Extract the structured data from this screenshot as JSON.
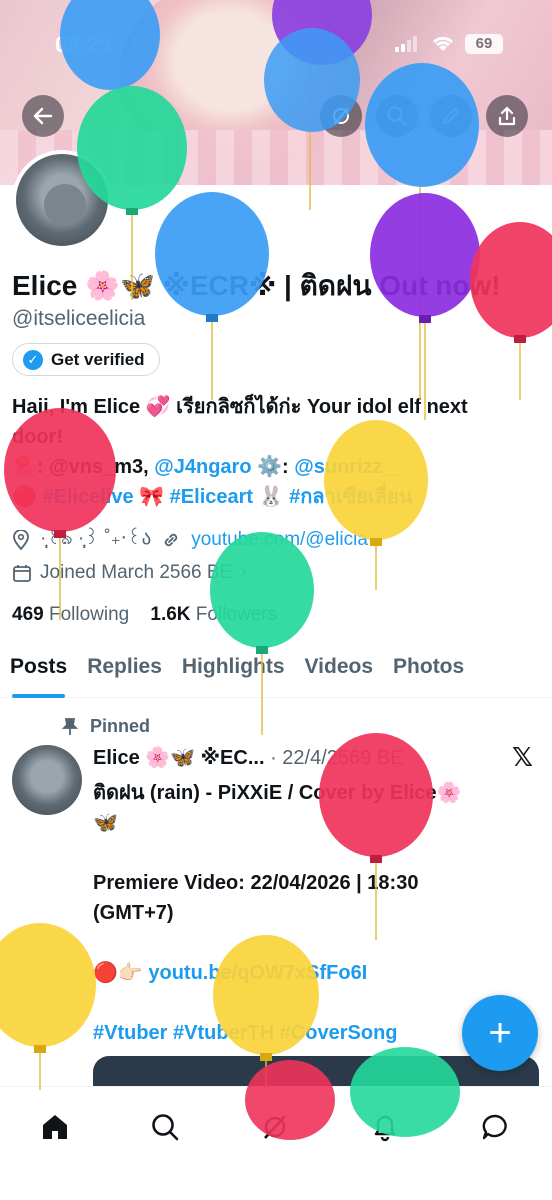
{
  "status": {
    "time": "08:25",
    "battery": "69"
  },
  "profile": {
    "name": "Elice 🌸🦋 ※ECR※ | ติดฝน Out now!",
    "handle": "@itseliceelicia",
    "verify_label": "Get verified",
    "bio_lines": [
      "Haii, I'm Elice 💞 เรียกลิซก็ได้ก่ะ Your idol elf next",
      "door!"
    ],
    "bio_line3": [
      "🪼: @vns_m3",
      ", ",
      "@J4ngaro",
      " ⚙️: ",
      "@sunrizz__"
    ],
    "bio_line4": [
      "🔴 ",
      "#Elicelive",
      " 🎀 ",
      "#Eliceart",
      " 🐰 ",
      "#กลาเซียเลี่ยน"
    ],
    "location": "·̩͙꒰ঌ ·̩͙꒱ ˚₊‧꒰ა",
    "link": "youtube.com/@elicia",
    "joined": "Joined March 2566 BE",
    "following_count": "469",
    "following_label": "Following",
    "followers_count": "1.6K",
    "followers_label": "Followers"
  },
  "tabs": [
    "Posts",
    "Replies",
    "Highlights",
    "Videos",
    "Photos"
  ],
  "post": {
    "pinned_label": "Pinned",
    "author": "Elice 🌸🦋 ※EC...",
    "date": "· 22/4/2569 BE",
    "line1": "ติดฝน (rain) - PiXXiE / Cover by Elice🌸",
    "line2": "🦋",
    "line3": "",
    "line4": "Premiere Video: 22/04/2026 | 18:30",
    "line5": "(GMT+7)",
    "line6": "",
    "link_prefix": "🔴👉🏻 ",
    "link": "youtu.be/qOW7xSfFo6I",
    "line8": "",
    "hashtags": "#Vtuber #VtuberTH #CoverSong"
  },
  "colors": {
    "accent": "#1d9bf0",
    "text": "#0f1419",
    "muted": "#536471"
  },
  "icons": [
    "back-arrow-icon",
    "grok-icon",
    "search-icon",
    "edit-icon",
    "share-icon",
    "home-icon",
    "explore-icon",
    "grok-nav-icon",
    "bell-icon",
    "messages-icon",
    "plus-icon",
    "x-logo-icon",
    "pin-icon",
    "location-icon",
    "link-icon",
    "calendar-icon",
    "verified-badge-icon"
  ]
}
